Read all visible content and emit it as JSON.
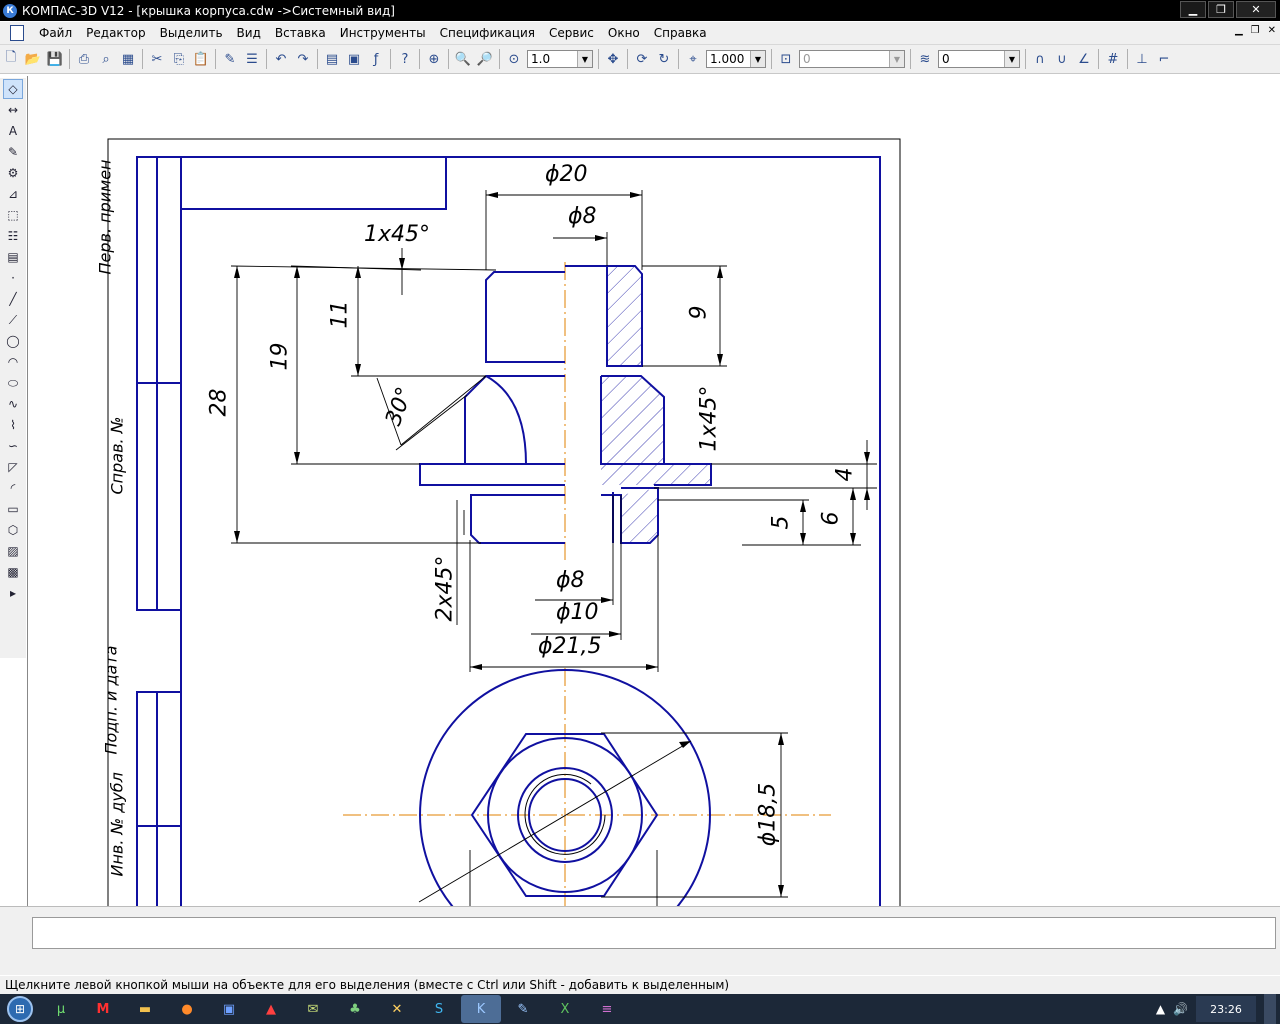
{
  "window": {
    "app_name": "КОМПАС-3D V12",
    "title": "КОМПАС-3D V12 - [крышка корпуса.cdw ->Системный вид]",
    "app_icon": "К"
  },
  "menu": [
    "Файл",
    "Редактор",
    "Выделить",
    "Вид",
    "Вставка",
    "Инструменты",
    "Спецификация",
    "Сервис",
    "Окно",
    "Справка"
  ],
  "toolbar": {
    "zoom_value": "1.0",
    "step_value": "1.000",
    "angle_value": "0",
    "layer_value": "0"
  },
  "drawing": {
    "stamp_labels": [
      "Перв. примен",
      "Справ. №",
      "Подп. и дата",
      "Инв. № дубл"
    ],
    "dims": {
      "d20": "ϕ20",
      "d8_top": "ϕ8",
      "chamfer_top": "1x45°",
      "h11": "11",
      "h19": "19",
      "h28": "28",
      "h9": "9",
      "angle30": "30°",
      "chamfer_right": "1x45°",
      "h4": "4",
      "h5": "5",
      "h6": "6",
      "chamfer_bottom": "2x45°",
      "d8_bottom": "ϕ8",
      "d10": "ϕ10",
      "d21_5": "ϕ21,5",
      "d18_5": "ϕ18,5"
    },
    "colors": {
      "outline": "#1010a0",
      "axis": "#e08000",
      "dim": "#000000"
    }
  },
  "status": {
    "hint": "Щелкните левой кнопкой мыши на объекте для его выделения (вместе с Ctrl или Shift - добавить к выделенным)"
  },
  "taskbar": {
    "clock": "23:26",
    "tasks": [
      "utorrent-icon",
      "metro-icon",
      "folder-icon",
      "firefox-icon",
      "floppy-icon",
      "pdf-icon",
      "mail-icon",
      "app-icon",
      "tool-icon",
      "skype-icon",
      "kompas-icon",
      "draw-icon",
      "excel-icon",
      "winrar-icon"
    ]
  }
}
